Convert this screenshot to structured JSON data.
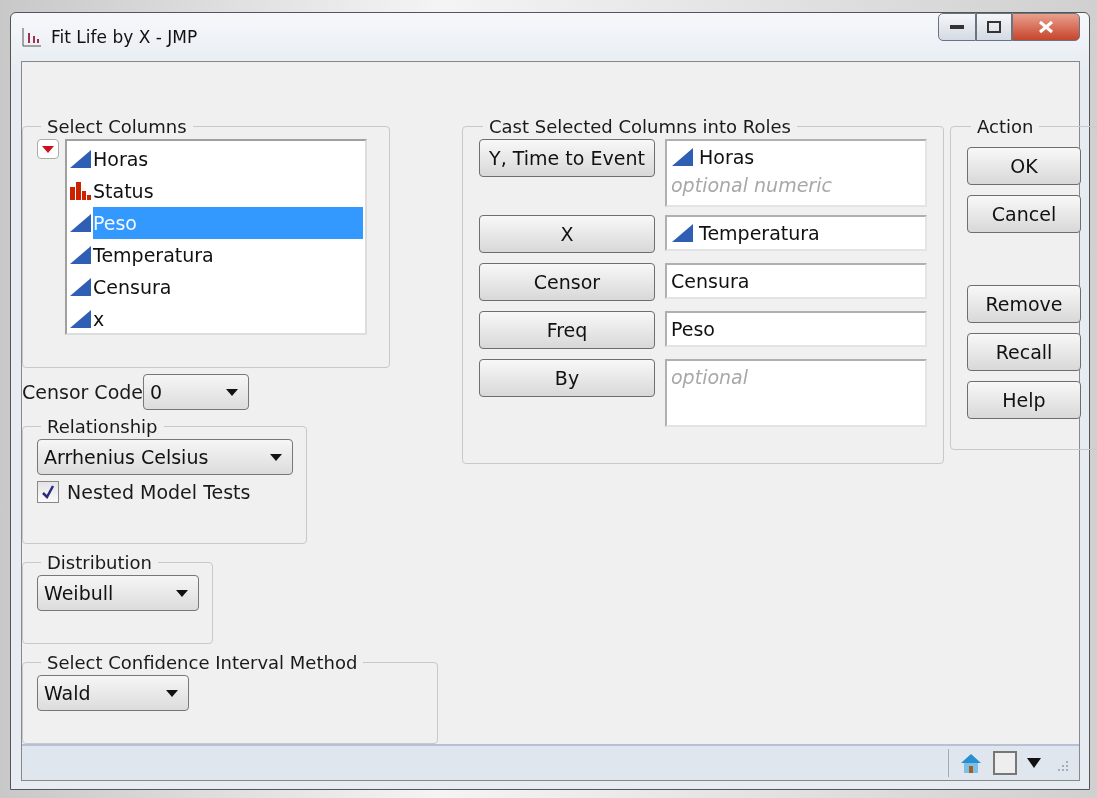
{
  "window": {
    "title": "Fit Life by X - JMP"
  },
  "select_columns": {
    "title": "Select Columns",
    "columns": [
      {
        "name": "Horas",
        "kind": "continuous",
        "selected": false
      },
      {
        "name": "Status",
        "kind": "nominal",
        "selected": false
      },
      {
        "name": "Peso",
        "kind": "continuous",
        "selected": true
      },
      {
        "name": "Temperatura",
        "kind": "continuous",
        "selected": false
      },
      {
        "name": "Censura",
        "kind": "continuous",
        "selected": false
      },
      {
        "name": "x",
        "kind": "continuous",
        "selected": false
      }
    ]
  },
  "censor_code": {
    "label": "Censor Code",
    "value": "0"
  },
  "relationship": {
    "title": "Relationship",
    "value": "Arrhenius Celsius",
    "nested_model_tests": {
      "label": "Nested Model Tests",
      "checked": true
    }
  },
  "distribution": {
    "title": "Distribution",
    "value": "Weibull"
  },
  "ci_method": {
    "title": "Select Confidence Interval Method",
    "value": "Wald"
  },
  "roles": {
    "title": "Cast Selected Columns into Roles",
    "items": [
      {
        "button": "Y, Time to Event",
        "entries": [
          {
            "name": "Horas",
            "kind": "continuous"
          }
        ],
        "placeholder": "optional numeric"
      },
      {
        "button": "X",
        "entries": [
          {
            "name": "Temperatura",
            "kind": "continuous"
          }
        ]
      },
      {
        "button": "Censor",
        "entries": [
          {
            "name": "Censura",
            "kind": "plain"
          }
        ]
      },
      {
        "button": "Freq",
        "entries": [
          {
            "name": "Peso",
            "kind": "plain"
          }
        ]
      },
      {
        "button": "By",
        "placeholder": "optional"
      }
    ]
  },
  "action": {
    "title": "Action",
    "top_buttons": [
      "OK",
      "Cancel"
    ],
    "bottom_buttons": [
      "Remove",
      "Recall",
      "Help"
    ]
  }
}
